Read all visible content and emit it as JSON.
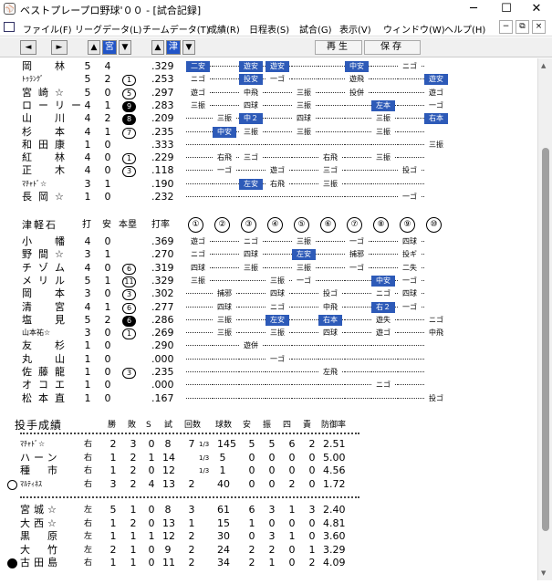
{
  "window": {
    "title": "ベストプレープロ野球'００ - [試合記録]",
    "minimize_glyph": "─",
    "maximize_glyph": "☐",
    "close_glyph": "✕",
    "app_icon": "baseball-icon",
    "app_icon_glyph": "⚾"
  },
  "menu": {
    "items": [
      "ファイル(F)",
      "リーグデータ(L)",
      "チームデータ(T)",
      "成績(R)",
      "日程表(S)",
      "試合(G)",
      "表示(V)",
      "ウィンドウ(W)",
      "ヘルプ(H)"
    ],
    "mdi_minimize": "−",
    "mdi_restore": "⧉",
    "mdi_close": "×"
  },
  "toolbar": {
    "left_arrow": "◄",
    "right_arrow": "►",
    "team1": "宮",
    "team2": "津",
    "up_arrow": "▲",
    "down_arrow": "▼",
    "replay": "再生",
    "save": "保存"
  },
  "team_a_batters": [
    {
      "name": "岡　林",
      "ab": "5",
      "h": "4",
      "hr": "",
      "avg": ".329",
      "pa": [
        [
          "二安",
          true
        ],
        [
          "",
          false
        ],
        [
          "遊安",
          true
        ],
        [
          "遊安",
          true
        ],
        [
          "",
          false
        ],
        [
          "",
          false
        ],
        [
          "中安",
          true
        ],
        [
          "",
          false
        ],
        [
          "ニゴ",
          false
        ],
        [
          "",
          false
        ]
      ]
    },
    {
      "name": "ﾄｩﾗﾝｸﾞ",
      "small": true,
      "ab": "5",
      "h": "2",
      "hr": "1",
      "hr_filled": false,
      "avg": ".253",
      "pa": [
        [
          "ニゴ",
          false
        ],
        [
          "",
          false
        ],
        [
          "投安",
          true
        ],
        [
          "一ゴ",
          false
        ],
        [
          "",
          false
        ],
        [
          "",
          false
        ],
        [
          "遊飛",
          false
        ],
        [
          "",
          false
        ],
        [
          "",
          false
        ],
        [
          "遊安",
          true
        ]
      ]
    },
    {
      "name": "宮崎☆",
      "ab": "5",
      "h": "0",
      "hr": "5",
      "hr_filled": false,
      "avg": ".297",
      "pa": [
        [
          "遊ゴ",
          false
        ],
        [
          "",
          false
        ],
        [
          "中飛",
          false
        ],
        [
          "",
          false
        ],
        [
          "三振",
          false
        ],
        [
          "",
          false
        ],
        [
          "投併",
          false
        ],
        [
          "",
          false
        ],
        [
          "",
          false
        ],
        [
          "遊ゴ",
          false
        ]
      ]
    },
    {
      "name": "ローリー",
      "ab": "4",
      "h": "1",
      "hr": "9",
      "hr_filled": true,
      "avg": ".283",
      "pa": [
        [
          "三振",
          false
        ],
        [
          "",
          false
        ],
        [
          "四球",
          false
        ],
        [
          "",
          false
        ],
        [
          "三振",
          false
        ],
        [
          "",
          false
        ],
        [
          "",
          false
        ],
        [
          "左本",
          true
        ],
        [
          "",
          false
        ],
        [
          "一ゴ",
          false
        ]
      ]
    },
    {
      "name": "山　川",
      "ab": "4",
      "h": "2",
      "hr": "8",
      "hr_filled": true,
      "avg": ".209",
      "pa": [
        [
          "",
          false
        ],
        [
          "三振",
          false
        ],
        [
          "中２",
          true
        ],
        [
          "",
          false
        ],
        [
          "四球",
          false
        ],
        [
          "",
          false
        ],
        [
          "",
          false
        ],
        [
          "三振",
          false
        ],
        [
          "",
          false
        ],
        [
          "右本",
          true
        ]
      ]
    },
    {
      "name": "杉　本",
      "ab": "4",
      "h": "1",
      "hr": "7",
      "hr_filled": false,
      "avg": ".235",
      "pa": [
        [
          "",
          false
        ],
        [
          "中安",
          true
        ],
        [
          "三振",
          false
        ],
        [
          "",
          false
        ],
        [
          "三振",
          false
        ],
        [
          "",
          false
        ],
        [
          "",
          false
        ],
        [
          "三振",
          false
        ],
        [
          "",
          false
        ],
        [
          "",
          false
        ]
      ]
    },
    {
      "name": "和田康",
      "ab": "1",
      "h": "0",
      "hr": "",
      "avg": ".333",
      "pa": [
        [
          "",
          false
        ],
        [
          "",
          false
        ],
        [
          "",
          false
        ],
        [
          "",
          false
        ],
        [
          "",
          false
        ],
        [
          "",
          false
        ],
        [
          "",
          false
        ],
        [
          "",
          false
        ],
        [
          "",
          false
        ],
        [
          "三振",
          false
        ]
      ]
    },
    {
      "name": "紅　林",
      "ab": "4",
      "h": "0",
      "hr": "1",
      "hr_filled": false,
      "avg": ".229",
      "pa": [
        [
          "",
          false
        ],
        [
          "右飛",
          false
        ],
        [
          "三ゴ",
          false
        ],
        [
          "",
          false
        ],
        [
          "",
          false
        ],
        [
          "右飛",
          false
        ],
        [
          "",
          false
        ],
        [
          "三振",
          false
        ],
        [
          "",
          false
        ],
        [
          "",
          false
        ]
      ]
    },
    {
      "name": "正　木",
      "ab": "4",
      "h": "0",
      "hr": "3",
      "hr_filled": false,
      "avg": ".118",
      "pa": [
        [
          "",
          false
        ],
        [
          "一ゴ",
          false
        ],
        [
          "",
          false
        ],
        [
          "遊ゴ",
          false
        ],
        [
          "",
          false
        ],
        [
          "三ゴ",
          false
        ],
        [
          "",
          false
        ],
        [
          "",
          false
        ],
        [
          "投ゴ",
          false
        ],
        [
          "",
          false
        ]
      ]
    },
    {
      "name": "ﾏﾁｬﾄﾞ☆",
      "small": true,
      "ab": "3",
      "h": "1",
      "hr": "",
      "avg": ".190",
      "pa": [
        [
          "",
          false
        ],
        [
          "",
          false
        ],
        [
          "左安",
          true
        ],
        [
          "右飛",
          false
        ],
        [
          "",
          false
        ],
        [
          "三振",
          false
        ],
        [
          "",
          false
        ],
        [
          "",
          false
        ],
        [
          "",
          false
        ],
        [
          "",
          false
        ]
      ]
    },
    {
      "name": "長岡☆",
      "ab": "1",
      "h": "0",
      "hr": "",
      "avg": ".232",
      "pa": [
        [
          "",
          false
        ],
        [
          "",
          false
        ],
        [
          "",
          false
        ],
        [
          "",
          false
        ],
        [
          "",
          false
        ],
        [
          "",
          false
        ],
        [
          "",
          false
        ],
        [
          "",
          false
        ],
        [
          "一ゴ",
          false
        ],
        [
          "",
          false
        ]
      ]
    }
  ],
  "team_b_header": {
    "team": "津軽石",
    "ab": "打",
    "h": "安",
    "hr": "本塁",
    "avg": "打率",
    "innings": [
      "①",
      "②",
      "③",
      "④",
      "⑤",
      "⑥",
      "⑦",
      "⑧",
      "⑨",
      "⑩"
    ]
  },
  "team_b_batters": [
    {
      "name": "小　幡",
      "ab": "4",
      "h": "0",
      "hr": "",
      "avg": ".369",
      "pa": [
        [
          "遊ゴ",
          false
        ],
        [
          "",
          false
        ],
        [
          "ニゴ",
          false
        ],
        [
          "",
          false
        ],
        [
          "三振",
          false
        ],
        [
          "",
          false
        ],
        [
          "一ゴ",
          false
        ],
        [
          "",
          false
        ],
        [
          "四球",
          false
        ],
        [
          "",
          false
        ]
      ]
    },
    {
      "name": "野間☆",
      "ab": "3",
      "h": "1",
      "hr": "",
      "avg": ".270",
      "pa": [
        [
          "ニゴ",
          false
        ],
        [
          "",
          false
        ],
        [
          "四球",
          false
        ],
        [
          "",
          false
        ],
        [
          "左安",
          true
        ],
        [
          "",
          false
        ],
        [
          "捕邪",
          false
        ],
        [
          "",
          false
        ],
        [
          "投ギ",
          false
        ],
        [
          "",
          false
        ]
      ]
    },
    {
      "name": "チゾム",
      "ab": "4",
      "h": "0",
      "hr": "6",
      "hr_filled": false,
      "avg": ".319",
      "pa": [
        [
          "四球",
          false
        ],
        [
          "",
          false
        ],
        [
          "三振",
          false
        ],
        [
          "",
          false
        ],
        [
          "三振",
          false
        ],
        [
          "",
          false
        ],
        [
          "一ゴ",
          false
        ],
        [
          "",
          false
        ],
        [
          "二失",
          false
        ],
        [
          "",
          false
        ]
      ]
    },
    {
      "name": "メリル",
      "ab": "5",
      "h": "1",
      "hr": "11",
      "hr_filled": false,
      "avg": ".329",
      "pa": [
        [
          "三振",
          false
        ],
        [
          "",
          false
        ],
        [
          "",
          false
        ],
        [
          "三振",
          false
        ],
        [
          "一ゴ",
          false
        ],
        [
          "",
          false
        ],
        [
          "",
          false
        ],
        [
          "中安",
          true
        ],
        [
          "一ゴ",
          false
        ],
        [
          "",
          false
        ]
      ]
    },
    {
      "name": "岡　本",
      "ab": "3",
      "h": "0",
      "hr": "3",
      "hr_filled": false,
      "avg": ".302",
      "pa": [
        [
          "",
          false
        ],
        [
          "捕邪",
          false
        ],
        [
          "",
          false
        ],
        [
          "四球",
          false
        ],
        [
          "",
          false
        ],
        [
          "投ゴ",
          false
        ],
        [
          "",
          false
        ],
        [
          "ニゴ",
          false
        ],
        [
          "四球",
          false
        ],
        [
          "",
          false
        ]
      ]
    },
    {
      "name": "清　宮",
      "ab": "4",
      "h": "1",
      "hr": "6",
      "hr_filled": false,
      "avg": ".277",
      "pa": [
        [
          "",
          false
        ],
        [
          "四球",
          false
        ],
        [
          "",
          false
        ],
        [
          "ニゴ",
          false
        ],
        [
          "",
          false
        ],
        [
          "中飛",
          false
        ],
        [
          "",
          false
        ],
        [
          "右２",
          true
        ],
        [
          "一ゴ",
          false
        ],
        [
          "",
          false
        ]
      ]
    },
    {
      "name": "塩　見",
      "ab": "5",
      "h": "2",
      "hr": "6",
      "hr_filled": true,
      "avg": ".286",
      "pa": [
        [
          "",
          false
        ],
        [
          "三振",
          false
        ],
        [
          "",
          false
        ],
        [
          "左安",
          true
        ],
        [
          "",
          false
        ],
        [
          "右本",
          true
        ],
        [
          "",
          false
        ],
        [
          "遊失",
          false
        ],
        [
          "",
          false
        ],
        [
          "ニゴ",
          false
        ]
      ]
    },
    {
      "name": "山本祐☆",
      "small": true,
      "ab": "3",
      "h": "0",
      "hr": "1",
      "hr_filled": false,
      "avg": ".269",
      "pa": [
        [
          "",
          false
        ],
        [
          "三振",
          false
        ],
        [
          "",
          false
        ],
        [
          "三振",
          false
        ],
        [
          "",
          false
        ],
        [
          "四球",
          false
        ],
        [
          "",
          false
        ],
        [
          "遊ゴ",
          false
        ],
        [
          "",
          false
        ],
        [
          "中飛",
          false
        ]
      ]
    },
    {
      "name": "友　杉",
      "ab": "1",
      "h": "0",
      "hr": "",
      "avg": ".290",
      "pa": [
        [
          "",
          false
        ],
        [
          "",
          false
        ],
        [
          "遊併",
          false
        ],
        [
          "",
          false
        ],
        [
          "",
          false
        ],
        [
          "",
          false
        ],
        [
          "",
          false
        ],
        [
          "",
          false
        ],
        [
          "",
          false
        ],
        [
          "",
          false
        ]
      ]
    },
    {
      "name": "丸　山",
      "ab": "1",
      "h": "0",
      "hr": "",
      "avg": ".000",
      "pa": [
        [
          "",
          false
        ],
        [
          "",
          false
        ],
        [
          "",
          false
        ],
        [
          "一ゴ",
          false
        ],
        [
          "",
          false
        ],
        [
          "",
          false
        ],
        [
          "",
          false
        ],
        [
          "",
          false
        ],
        [
          "",
          false
        ],
        [
          "",
          false
        ]
      ]
    },
    {
      "name": "佐藤龍",
      "ab": "1",
      "h": "0",
      "hr": "3",
      "hr_filled": false,
      "avg": ".235",
      "pa": [
        [
          "",
          false
        ],
        [
          "",
          false
        ],
        [
          "",
          false
        ],
        [
          "",
          false
        ],
        [
          "",
          false
        ],
        [
          "左飛",
          false
        ],
        [
          "",
          false
        ],
        [
          "",
          false
        ],
        [
          "",
          false
        ],
        [
          "",
          false
        ]
      ]
    },
    {
      "name": "オコエ",
      "ab": "1",
      "h": "0",
      "hr": "",
      "avg": ".000",
      "pa": [
        [
          "",
          false
        ],
        [
          "",
          false
        ],
        [
          "",
          false
        ],
        [
          "",
          false
        ],
        [
          "",
          false
        ],
        [
          "",
          false
        ],
        [
          "",
          false
        ],
        [
          "ニゴ",
          false
        ],
        [
          "",
          false
        ],
        [
          "",
          false
        ]
      ]
    },
    {
      "name": "松本直",
      "ab": "1",
      "h": "0",
      "hr": "",
      "avg": ".167",
      "pa": [
        [
          "",
          false
        ],
        [
          "",
          false
        ],
        [
          "",
          false
        ],
        [
          "",
          false
        ],
        [
          "",
          false
        ],
        [
          "",
          false
        ],
        [
          "",
          false
        ],
        [
          "",
          false
        ],
        [
          "",
          false
        ],
        [
          "投ゴ",
          false
        ]
      ]
    }
  ],
  "pitching_header": {
    "title": "投手成績",
    "cols": [
      "勝",
      "敗",
      "S",
      "試",
      "回数",
      "球数",
      "安",
      "振",
      "四",
      "責",
      "防御率"
    ]
  },
  "pitchers_a": [
    {
      "name": "ﾏﾁｬﾄﾞ☆",
      "small": true,
      "hand": "右",
      "w": "2",
      "l": "3",
      "s": "0",
      "g": "8",
      "ip": "7",
      "frac": "1/3",
      "np": "145",
      "h": "5",
      "so": "5",
      "bb": "6",
      "er": "2",
      "era": "2.51",
      "mark": ""
    },
    {
      "name": "ハーン",
      "hand": "右",
      "w": "1",
      "l": "2",
      "s": "1",
      "g": "14",
      "ip": "",
      "frac": "1/3",
      "np": "5",
      "h": "0",
      "so": "0",
      "bb": "0",
      "er": "0",
      "era": "5.00",
      "mark": ""
    },
    {
      "name": "種　市",
      "hand": "右",
      "w": "1",
      "l": "2",
      "s": "0",
      "g": "12",
      "ip": "",
      "frac": "1/3",
      "np": "1",
      "h": "0",
      "so": "0",
      "bb": "0",
      "er": "0",
      "era": "4.56",
      "mark": ""
    },
    {
      "name": "ﾏﾙﾃｨﾈｽ",
      "small": true,
      "hand": "右",
      "w": "3",
      "l": "2",
      "s": "4",
      "g": "13",
      "ip": "2",
      "frac": "",
      "np": "40",
      "h": "0",
      "so": "0",
      "bb": "2",
      "er": "0",
      "era": "1.72",
      "mark": "loss"
    }
  ],
  "pitchers_b": [
    {
      "name": "宮城☆",
      "hand": "左",
      "w": "5",
      "l": "1",
      "s": "0",
      "g": "8",
      "ip": "3",
      "frac": "",
      "np": "61",
      "h": "6",
      "so": "3",
      "bb": "1",
      "er": "3",
      "era": "2.40",
      "mark": ""
    },
    {
      "name": "大西☆",
      "hand": "右",
      "w": "1",
      "l": "2",
      "s": "0",
      "g": "13",
      "ip": "1",
      "frac": "",
      "np": "15",
      "h": "1",
      "so": "0",
      "bb": "0",
      "er": "0",
      "era": "4.81",
      "mark": ""
    },
    {
      "name": "黒　原",
      "hand": "左",
      "w": "1",
      "l": "1",
      "s": "1",
      "g": "12",
      "ip": "2",
      "frac": "",
      "np": "30",
      "h": "0",
      "so": "3",
      "bb": "1",
      "er": "0",
      "era": "3.60",
      "mark": ""
    },
    {
      "name": "大　竹",
      "hand": "左",
      "w": "2",
      "l": "1",
      "s": "0",
      "g": "9",
      "ip": "2",
      "frac": "",
      "np": "24",
      "h": "2",
      "so": "2",
      "bb": "0",
      "er": "1",
      "era": "3.29",
      "mark": ""
    },
    {
      "name": "古田島",
      "hand": "右",
      "w": "1",
      "l": "1",
      "s": "0",
      "g": "11",
      "ip": "2",
      "frac": "",
      "np": "34",
      "h": "2",
      "so": "1",
      "bb": "0",
      "er": "2",
      "era": "4.09",
      "mark": "win"
    }
  ]
}
